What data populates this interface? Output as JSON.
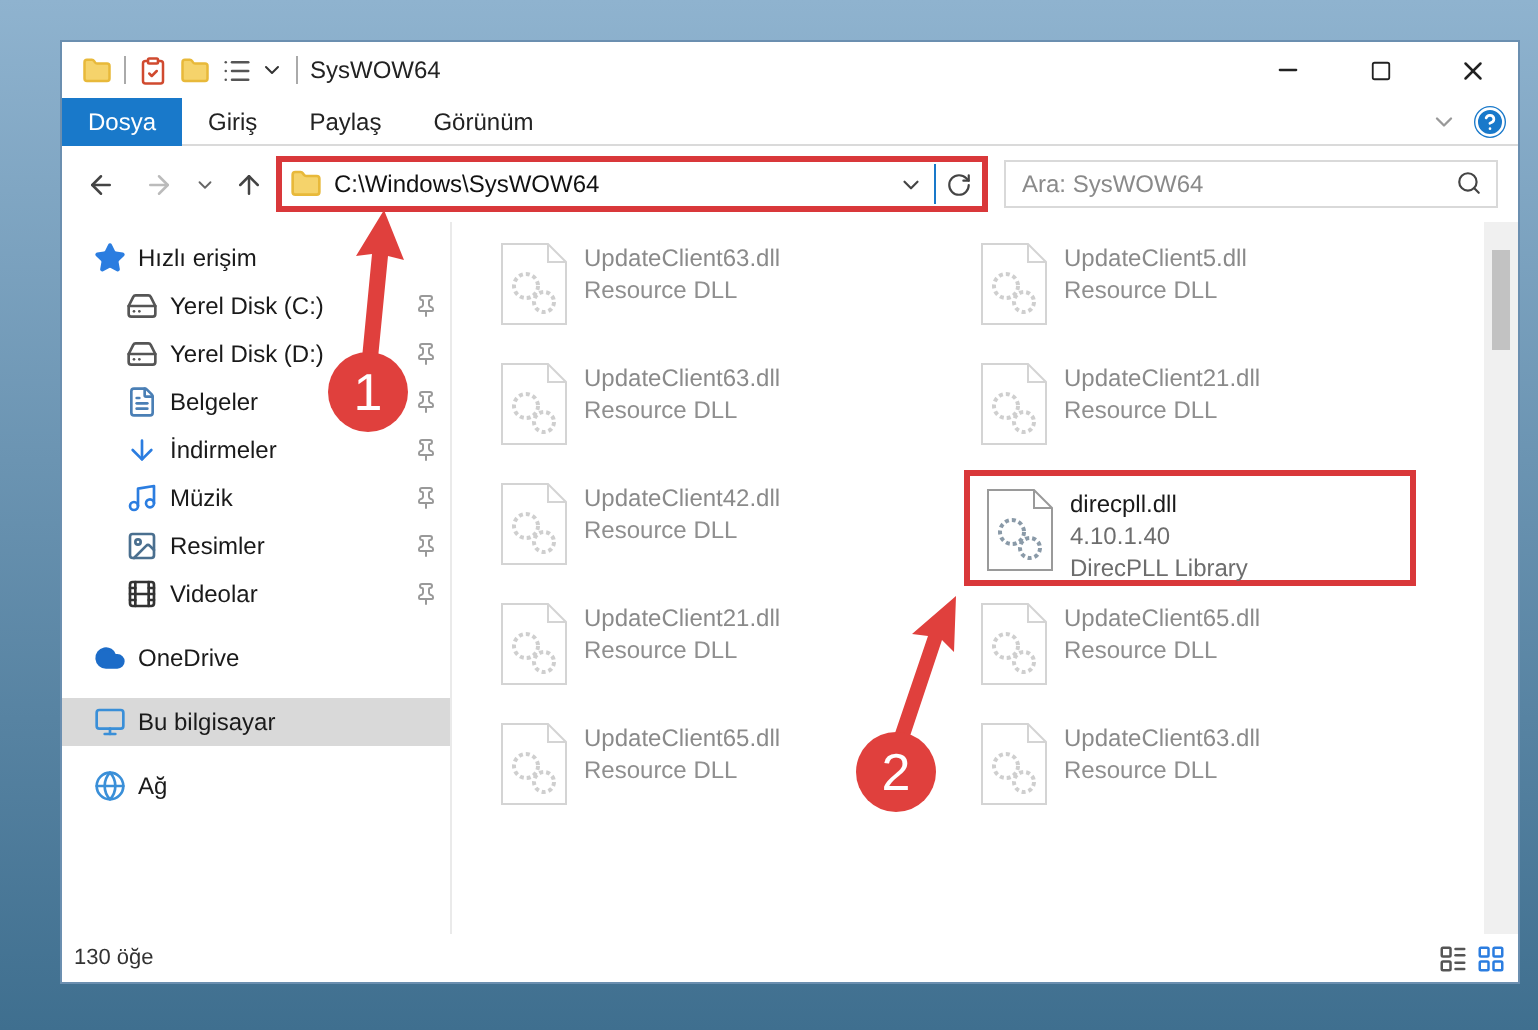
{
  "window": {
    "title": "SysWOW64"
  },
  "ribbon_tabs": [
    {
      "label": "Dosya",
      "kind": "file"
    },
    {
      "label": "Giriş",
      "kind": "tab"
    },
    {
      "label": "Paylaş",
      "kind": "tab"
    },
    {
      "label": "Görünüm",
      "kind": "tab"
    }
  ],
  "address_bar": {
    "path": "C:\\Windows\\SysWOW64",
    "highlighted": true
  },
  "search": {
    "placeholder": "Ara: SysWOW64"
  },
  "sidebar": {
    "items": [
      {
        "label": "Hızlı erişim",
        "pinned": false,
        "selected": false,
        "children": [
          {
            "label": "Yerel Disk (C:)",
            "pinned": true,
            "selected": false
          },
          {
            "label": "Yerel Disk (D:)",
            "pinned": true,
            "selected": false
          },
          {
            "label": "Belgeler",
            "pinned": true,
            "selected": false
          },
          {
            "label": "İndirmeler",
            "pinned": true,
            "selected": false
          },
          {
            "label": "Müzik",
            "pinned": true,
            "selected": false
          },
          {
            "label": "Resimler",
            "pinned": true,
            "selected": false
          },
          {
            "label": "Videolar",
            "pinned": true,
            "selected": false
          }
        ]
      },
      {
        "label": "OneDrive",
        "pinned": false,
        "selected": false
      },
      {
        "label": "Bu bilgisayar",
        "pinned": false,
        "selected": true
      },
      {
        "label": "Ağ",
        "pinned": false,
        "selected": false
      }
    ]
  },
  "files": [
    {
      "name": "UpdateClient63.dll",
      "description": "Resource DLL",
      "highlighted": false
    },
    {
      "name": "UpdateClient5.dll",
      "description": "Resource DLL",
      "highlighted": false
    },
    {
      "name": "UpdateClient63.dll",
      "description": "Resource DLL",
      "highlighted": false
    },
    {
      "name": "UpdateClient21.dll",
      "description": "Resource DLL",
      "highlighted": false
    },
    {
      "name": "UpdateClient42.dll",
      "description": "Resource DLL",
      "highlighted": false
    },
    {
      "name": "direcpll.dll",
      "version": "4.10.1.40",
      "description": "DirecPLL Library",
      "highlighted": true
    },
    {
      "name": "UpdateClient21.dll",
      "description": "Resource DLL",
      "highlighted": false
    },
    {
      "name": "UpdateClient65.dll",
      "description": "Resource DLL",
      "highlighted": false
    },
    {
      "name": "UpdateClient65.dll",
      "description": "Resource DLL",
      "highlighted": false
    },
    {
      "name": "UpdateClient63.dll",
      "description": "Resource DLL",
      "highlighted": false
    }
  ],
  "callouts": [
    {
      "number": "1"
    },
    {
      "number": "2"
    }
  ],
  "status_bar": {
    "count": "130 öğe"
  }
}
